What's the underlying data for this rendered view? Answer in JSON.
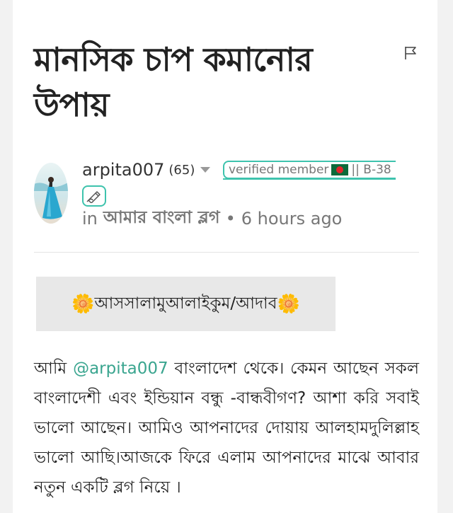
{
  "post": {
    "title": "মানসিক চাপ কমানোর উপায়"
  },
  "author": {
    "name": "arpita007",
    "reputation": "(65)",
    "badge": {
      "text_before_flag": "verified member",
      "text_after_flag": "|| B-38"
    },
    "community_prefix": "in",
    "community": "আমার বাংলা ব্লগ",
    "separator": "•",
    "time_ago": "6 hours ago"
  },
  "content": {
    "greeting": "আসসালামুআলাইকুম/আদাব",
    "greeting_icon": "🌼",
    "para_prefix": "আমি",
    "mention": "@arpita007",
    "para_rest": "বাংলাদেশ থেকে। কেমন আছেন সকল বাংলাদেশী এবং ইন্ডিয়ান বন্ধু -বান্ধবীগণ? আশা করি সবাই ভালো আছেন। আমিও আপনাদের দোয়ায় আলহামদুলিল্লাহ ভালো আছি।আজকে ফিরে এলাম আপনাদের মাঝে আবার নতুন একটি ব্লগ নিয়ে ।"
  },
  "icons": {
    "flag": "flag-icon",
    "caret": "caret-down-icon",
    "edit": "pen-badge-icon"
  },
  "colors": {
    "accent": "#3ec3ad",
    "mention": "#3aa58f",
    "bd_green": "#0b6a3a",
    "bd_red": "#e0242b"
  }
}
